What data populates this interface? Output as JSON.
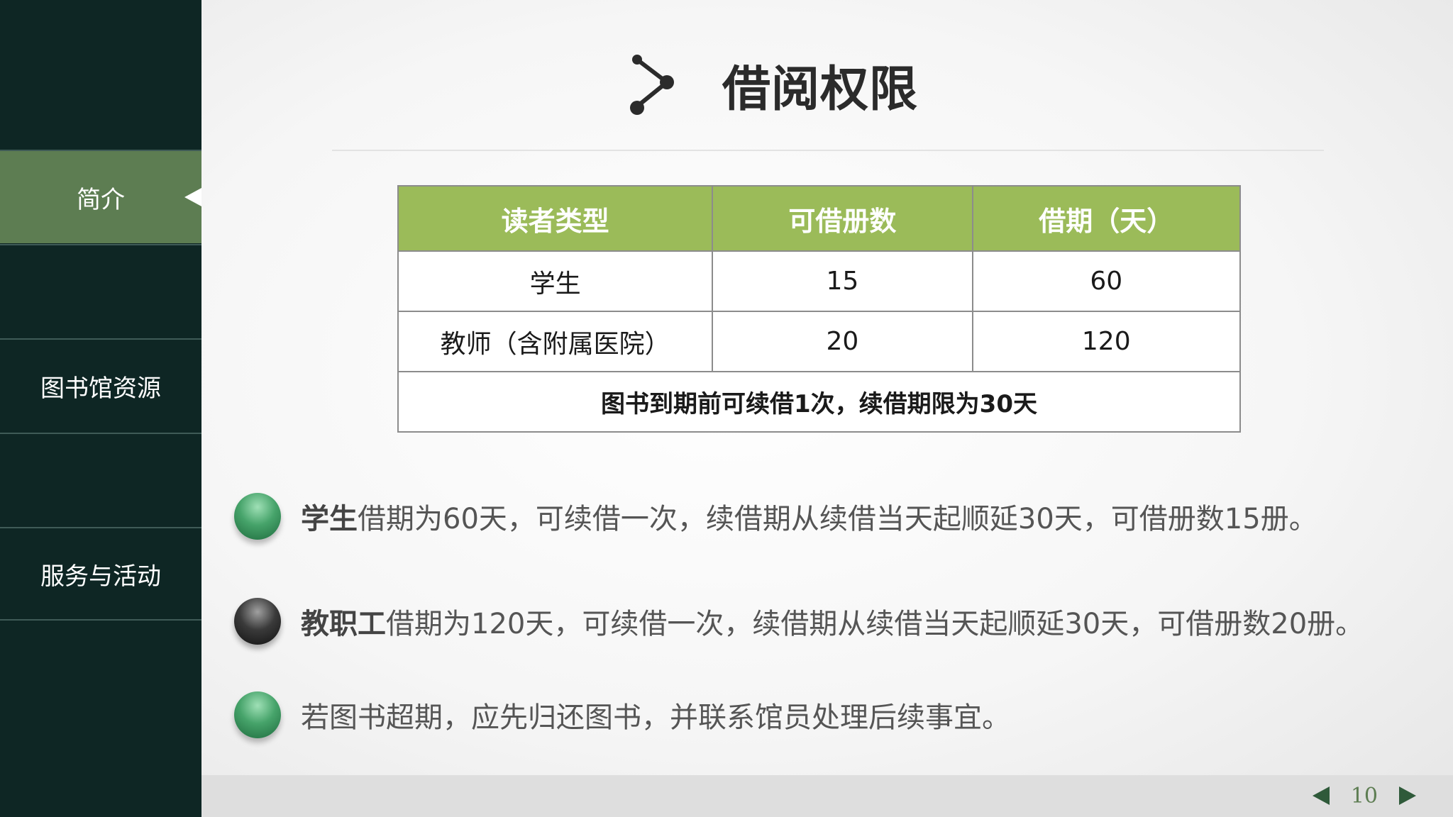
{
  "sidebar": {
    "items": [
      {
        "label": "简介",
        "active": true
      },
      {
        "label": ""
      },
      {
        "label": "图书馆资源"
      },
      {
        "label": ""
      },
      {
        "label": "服务与活动"
      }
    ]
  },
  "title": {
    "text": "借阅权限",
    "icon": "share-node-icon"
  },
  "table": {
    "headers": [
      "读者类型",
      "可借册数",
      "借期（天）"
    ],
    "rows": [
      [
        "学生",
        "15",
        "60"
      ],
      [
        "教师（含附属医院）",
        "20",
        "120"
      ]
    ],
    "note": "图书到期前可续借1次，续借期限为30天",
    "header_color": "#9bbb59"
  },
  "bullets": [
    {
      "bold": "学生",
      "text": "借期为60天，可续借一次，续借期从续借当天起顺延30天，可借册数15册。",
      "ball": "green"
    },
    {
      "bold": "教职工",
      "text": "借期为120天，可续借一次，续借期从续借当天起顺延30天，可借册数20册。",
      "ball": "dark"
    },
    {
      "bold": "",
      "text": "若图书超期，应先归还图书，并联系馆员处理后续事宜。",
      "ball": "green"
    }
  ],
  "pager": {
    "page_number": "10",
    "prev_icon": "triangle-left-icon",
    "next_icon": "triangle-right-icon"
  },
  "colors": {
    "sidebar_bg": "#0e2624",
    "active_item": "#5d7d52",
    "accent_green": "#9bbb59"
  }
}
